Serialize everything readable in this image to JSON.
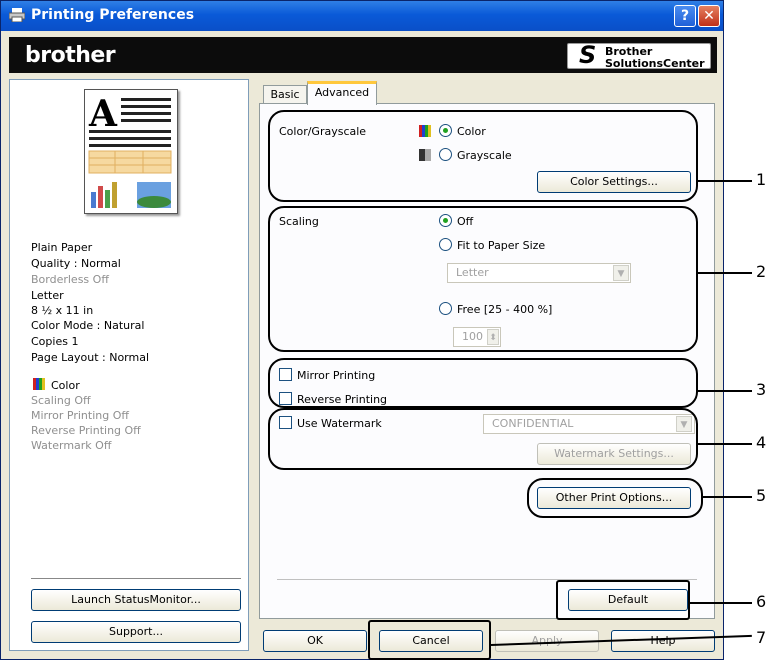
{
  "window": {
    "title": "Printing Preferences",
    "help_glyph": "?",
    "close_glyph": "✕"
  },
  "brand": {
    "logo": "brother",
    "sc_line1": "Brother",
    "sc_line2": "SolutionsCenter"
  },
  "summary": {
    "lines": [
      {
        "text": "Plain Paper",
        "dim": false
      },
      {
        "text": "Quality : Normal",
        "dim": false
      },
      {
        "text": "Borderless Off",
        "dim": true
      },
      {
        "text": "Letter",
        "dim": false
      },
      {
        "text": "8 ½ x 11 in",
        "dim": false
      },
      {
        "text": "Color Mode : Natural",
        "dim": false
      },
      {
        "text": "Copies 1",
        "dim": false
      },
      {
        "text": "Page Layout : Normal",
        "dim": false
      }
    ],
    "color_label": "Color",
    "status_lines": [
      "Scaling Off",
      "Mirror Printing Off",
      "Reverse Printing Off",
      "Watermark Off"
    ],
    "preview_letter": "A"
  },
  "left_buttons": {
    "launch": "Launch StatusMonitor...",
    "support": "Support..."
  },
  "tabs": [
    "Basic",
    "Advanced"
  ],
  "color": {
    "label": "Color/Grayscale",
    "option_color": "Color",
    "option_grayscale": "Grayscale",
    "selected": "Color",
    "settings_button": "Color Settings..."
  },
  "scaling": {
    "label": "Scaling",
    "option_off": "Off",
    "option_fit": "Fit to Paper Size",
    "paper_select": "Letter",
    "option_free": "Free [25 - 400 %]",
    "free_value": "100",
    "selected": "Off"
  },
  "printing": {
    "mirror": "Mirror Printing",
    "reverse": "Reverse Printing"
  },
  "watermark": {
    "use": "Use Watermark",
    "select": "CONFIDENTIAL",
    "settings_button": "Watermark Settings..."
  },
  "other_button": "Other Print Options...",
  "default_button": "Default",
  "bottom_buttons": {
    "ok": "OK",
    "cancel": "Cancel",
    "apply": "Apply",
    "help": "Help"
  },
  "callouts": [
    "1",
    "2",
    "3",
    "4",
    "5",
    "6",
    "7"
  ],
  "colors": {
    "titlebar": "#0a5ad8",
    "brand_bar": "#0c0c0c",
    "dialog_bg": "#ece9d8",
    "radio_dot": "#21a121"
  }
}
